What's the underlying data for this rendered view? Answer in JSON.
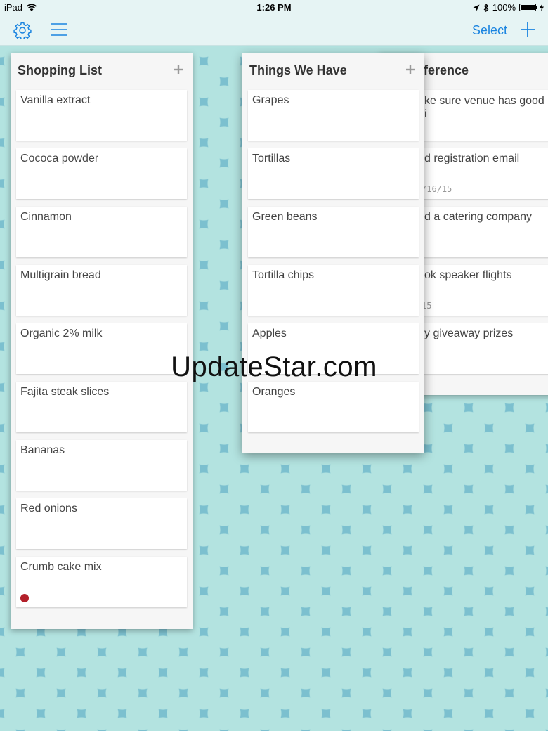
{
  "status_bar": {
    "device": "iPad",
    "time": "1:26 PM",
    "battery": "100%"
  },
  "nav": {
    "select_label": "Select"
  },
  "lists": {
    "shopping": {
      "title": "Shopping List",
      "items": [
        {
          "text": "Vanilla extract"
        },
        {
          "text": "Cococa powder"
        },
        {
          "text": "Cinnamon"
        },
        {
          "text": "Multigrain bread"
        },
        {
          "text": "Organic 2% milk"
        },
        {
          "text": "Fajita steak slices"
        },
        {
          "text": "Bananas"
        },
        {
          "text": "Red onions"
        },
        {
          "text": "Crumb cake mix",
          "label_color": "#b3202a"
        }
      ]
    },
    "things": {
      "title": "Things We Have",
      "items": [
        {
          "text": "Grapes"
        },
        {
          "text": "Tortillas"
        },
        {
          "text": "Green beans"
        },
        {
          "text": "Tortilla chips"
        },
        {
          "text": "Apples"
        },
        {
          "text": "Oranges"
        }
      ]
    },
    "conference": {
      "title": "nference",
      "items": [
        {
          "text": "ke sure venue has good",
          "line2": "i"
        },
        {
          "text": "d registration email",
          "date": "/16/15"
        },
        {
          "text": "d a catering company"
        },
        {
          "text": "ok speaker flights",
          "date": "15"
        },
        {
          "text": "y giveaway prizes"
        }
      ]
    }
  },
  "watermark": "UpdateStar.com",
  "colors": {
    "accent": "#1a84e0",
    "label_red": "#b3202a"
  }
}
